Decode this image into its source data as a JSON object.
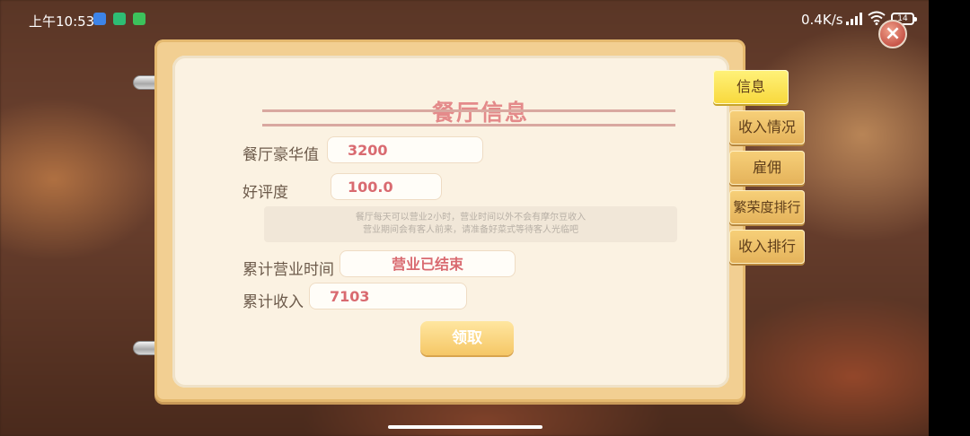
{
  "status_bar": {
    "time": "上午10:53",
    "net_speed": "0.4K/s",
    "battery": "14",
    "app_icons": [
      "app-icon-blue",
      "shield-app-icon",
      "wechat-icon"
    ]
  },
  "panel": {
    "title": "餐厅信息",
    "luxury_label": "餐厅豪华值",
    "luxury_value": "3200",
    "rating_label": "好评度",
    "rating_value": "100.0",
    "notice_line1": "餐厅每天可以营业2小时，营业时间以外不会有摩尔豆收入",
    "notice_line2": "营业期间会有客人前来，请准备好菜式等待客人光临吧",
    "business_time_label": "累计营业时间",
    "business_time_value": "营业已结束",
    "income_label": "累计收入",
    "income_value": "7103",
    "claim_label": "领取"
  },
  "tabs": [
    {
      "label": "信息",
      "active": true
    },
    {
      "label": "收入情况",
      "active": false
    },
    {
      "label": "雇佣",
      "active": false
    },
    {
      "label": "繁荣度排行",
      "active": false
    },
    {
      "label": "收入排行",
      "active": false
    }
  ],
  "colors": {
    "accent_title": "#e48a8a",
    "value_text": "#d96a70",
    "tab_active": "#f8d83c",
    "tab": "#e4b25a"
  }
}
